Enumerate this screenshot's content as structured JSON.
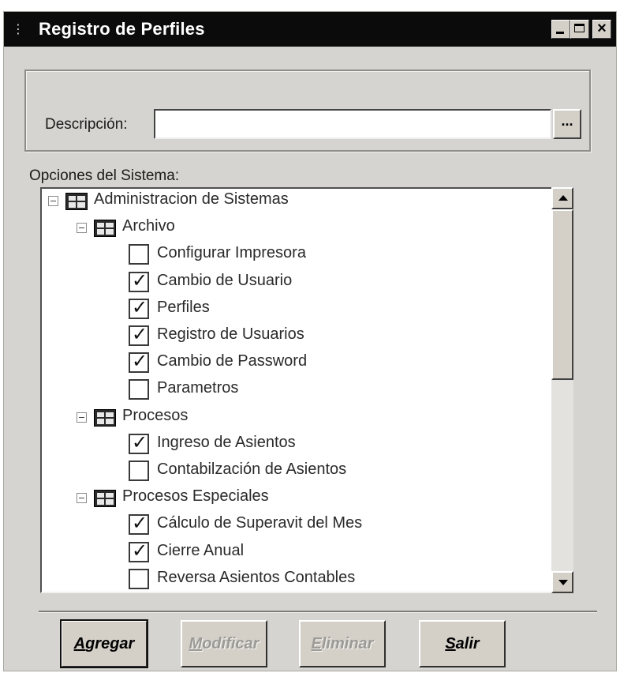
{
  "window": {
    "title": "Registro de Perfiles",
    "title_icon": "app-icon",
    "controls": [
      "minimize",
      "maximize",
      "close"
    ],
    "close_glyph": "×"
  },
  "description": {
    "label": "Descripción:",
    "value": "",
    "browse_label": "..."
  },
  "options": {
    "label": "Opciones del Sistema:",
    "tree": [
      {
        "type": "group",
        "level": 0,
        "label": "Administracion de Sistemas",
        "expanded": true
      },
      {
        "type": "group",
        "level": 1,
        "label": "Archivo",
        "expanded": true
      },
      {
        "type": "item",
        "level": 2,
        "label": "Configurar Impresora",
        "checked": false
      },
      {
        "type": "item",
        "level": 2,
        "label": "Cambio de Usuario",
        "checked": true
      },
      {
        "type": "item",
        "level": 2,
        "label": "Perfiles",
        "checked": true
      },
      {
        "type": "item",
        "level": 2,
        "label": "Registro de Usuarios",
        "checked": true
      },
      {
        "type": "item",
        "level": 2,
        "label": "Cambio de Password",
        "checked": true
      },
      {
        "type": "item",
        "level": 2,
        "label": "Parametros",
        "checked": false
      },
      {
        "type": "group",
        "level": 1,
        "label": "Procesos",
        "expanded": true
      },
      {
        "type": "item",
        "level": 2,
        "label": "Ingreso de Asientos",
        "checked": true
      },
      {
        "type": "item",
        "level": 2,
        "label": "Contabilzación de Asientos",
        "checked": false
      },
      {
        "type": "group",
        "level": 1,
        "label": "Procesos Especiales",
        "expanded": true
      },
      {
        "type": "item",
        "level": 2,
        "label": "Cálculo de Superavit del Mes",
        "checked": true
      },
      {
        "type": "item",
        "level": 2,
        "label": "Cierre Anual",
        "checked": true
      },
      {
        "type": "item",
        "level": 2,
        "label": "Reversa Asientos Contables",
        "checked": false
      }
    ]
  },
  "buttons": {
    "add": {
      "label": "Agregar",
      "mnemonic": "A",
      "rest": "gregar",
      "enabled": true
    },
    "modify": {
      "label": "Modificar",
      "mnemonic": "M",
      "rest": "odificar",
      "enabled": false
    },
    "delete": {
      "label": "Eliminar",
      "mnemonic": "E",
      "rest": "liminar",
      "enabled": false
    },
    "exit": {
      "label": "Salir",
      "mnemonic": "S",
      "rest": "alir",
      "enabled": true
    }
  },
  "colors": {
    "titlebar": "#0b0b0b",
    "window_face": "#d6d4d0",
    "disabled_text": "#9c9a96"
  }
}
